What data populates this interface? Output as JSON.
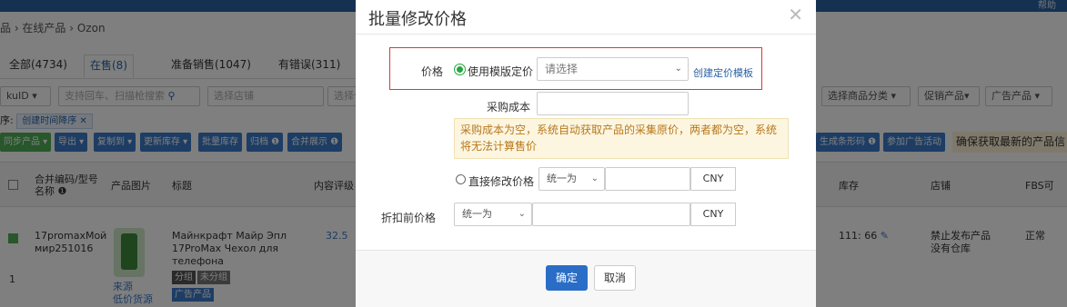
{
  "topbar": {
    "help": "帮助"
  },
  "breadcrumb": "品 › 在线产品 › Ozon",
  "tabs": [
    {
      "label": "全部(4734)"
    },
    {
      "label": "在售(8)"
    },
    {
      "label": "准备销售(1047)"
    },
    {
      "label": "有错误(311)"
    }
  ],
  "filters": {
    "sku_type": "kuID",
    "search_placeholder": "支持回车、扫描枪搜索",
    "store_placeholder": "选择店铺",
    "warehouse_placeholder": "选择仓",
    "category_placeholder": "选择商品分类",
    "promo": "促销产品",
    "ads": "广告产品"
  },
  "sort": {
    "label": "序:",
    "tag": "创建时间降序"
  },
  "toolbar": {
    "sync": "同步产品",
    "export": "导出",
    "copy_to": "复制到",
    "update_stock": "更新库存",
    "batch_stock": "批量库存",
    "archive": "归档",
    "merge": "合并展示",
    "barcode": "生成条形码",
    "join_ads": "参加广告活动",
    "notice": "确保获取最新的产品信"
  },
  "table": {
    "headers": {
      "merge_code": "合并编码/型号",
      "name": "名称",
      "image": "产品图片",
      "title": "标题",
      "content_rating": "内容评级",
      "stock": "库存",
      "store": "店铺",
      "fbs": "FBS可"
    },
    "row": {
      "code": "17promaxМой",
      "code2": "мир251016",
      "index": "1",
      "source": "来源",
      "source2": "低价货源",
      "title": "Майнкрафт Майр Эпл 17ProMax Чехол для телефона",
      "group_tag": "分组",
      "ungroup_tag": "未分组",
      "ad_tag": "广告产品",
      "rating": "32.5",
      "stock": "111: 66",
      "store": "禁止发布产品 没有仓库",
      "fbs": "正常"
    }
  },
  "modal": {
    "title": "批量修改价格",
    "price_label": "价格",
    "use_template": "使用模版定价",
    "template_placeholder": "请选择",
    "create_template": "创建定价模板",
    "cost_label": "采购成本",
    "warning": "采购成本为空，系统自动获取产品的采集原价，两者都为空，系统将无法计算售价",
    "direct_edit": "直接修改价格",
    "direct_mode": "统一为",
    "currency": "CNY",
    "pre_discount_label": "折扣前价格",
    "pre_discount_mode": "统一为",
    "confirm": "确定",
    "cancel": "取消"
  },
  "colors": {
    "primary": "#2a6dc7",
    "radio_checked": "#23a73f",
    "highlight_border": "#e0353b",
    "warning_bg": "#fcf6e1",
    "warning_text": "#b9771a",
    "topbar": "#2a62a4"
  }
}
